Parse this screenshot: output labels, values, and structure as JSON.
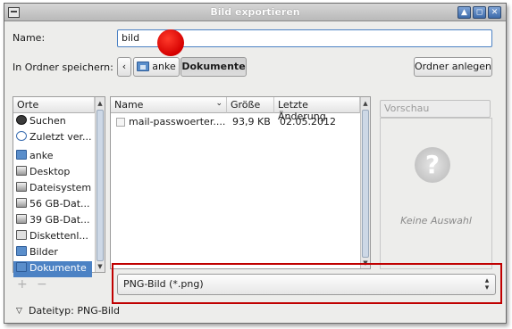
{
  "window": {
    "title": "Bild exportieren"
  },
  "name": {
    "label": "Name:",
    "value": "bild"
  },
  "folder": {
    "label": "In Ordner speichern:",
    "back_symbol": "‹",
    "crumbs": [
      "anke",
      "Dokumente"
    ],
    "create_button": "Ordner anlegen"
  },
  "places": {
    "header": "Orte",
    "items": [
      {
        "label": "Suchen",
        "icon": "search-icon"
      },
      {
        "label": "Zuletzt ver...",
        "icon": "recent-icon"
      },
      {
        "label": "anke",
        "icon": "home-folder-icon"
      },
      {
        "label": "Desktop",
        "icon": "desktop-icon"
      },
      {
        "label": "Dateisystem",
        "icon": "drive-icon"
      },
      {
        "label": "56 GB-Dat...",
        "icon": "drive-icon"
      },
      {
        "label": "39 GB-Dat...",
        "icon": "drive-icon"
      },
      {
        "label": "Diskettenl...",
        "icon": "floppy-icon"
      },
      {
        "label": "Bilder",
        "icon": "folder-icon"
      },
      {
        "label": "Dokumente",
        "icon": "folder-icon"
      }
    ],
    "add_symbol": "+",
    "remove_symbol": "−"
  },
  "files": {
    "headers": {
      "name": "Name",
      "size": "Größe",
      "modified": "Letzte Änderung"
    },
    "rows": [
      {
        "name": "mail-passwoerter....",
        "size": "93,9 KB",
        "modified": "02.05.2012"
      }
    ]
  },
  "preview": {
    "button": "Vorschau",
    "empty": "Keine Auswahl"
  },
  "filetype": {
    "selected": "PNG-Bild (*.png)",
    "footer_label": "Dateityp: PNG-Bild"
  },
  "colors": {
    "selection": "#4c82c4",
    "highlight_box": "#c00000",
    "marker_dot": "#e00000"
  }
}
